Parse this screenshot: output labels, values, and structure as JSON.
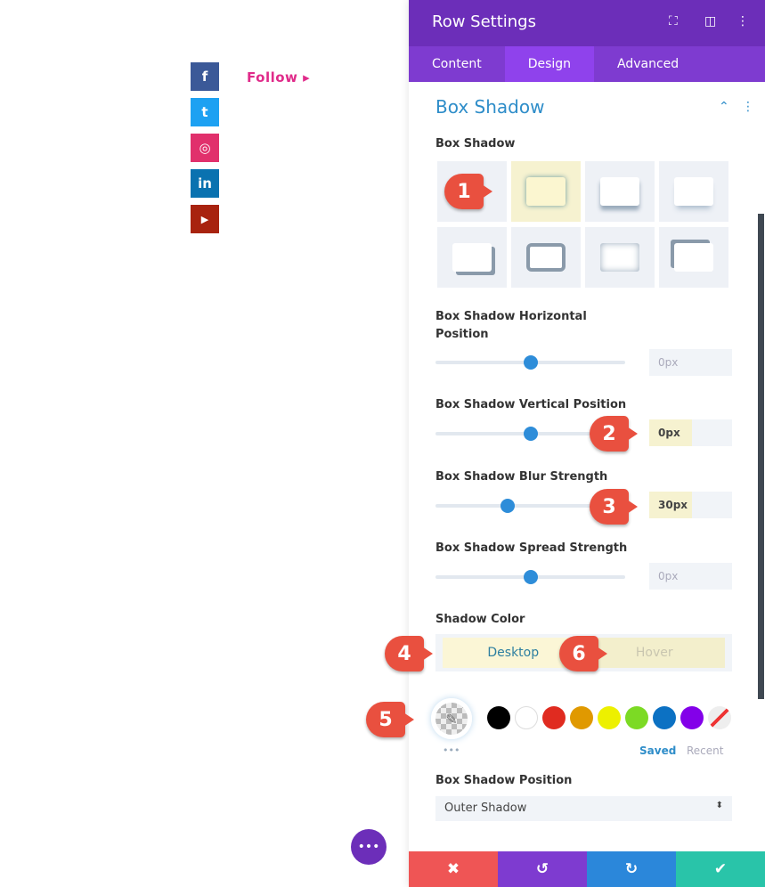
{
  "social": {
    "follow_label": "Follow ▸",
    "icons": [
      {
        "name": "facebook",
        "glyph": "f",
        "color": "#3b5998"
      },
      {
        "name": "twitter",
        "glyph": "t",
        "color": "#1da1f2"
      },
      {
        "name": "instagram",
        "glyph": "◎",
        "color": "#e1306c"
      },
      {
        "name": "linkedin",
        "glyph": "in",
        "color": "#0a72b0"
      },
      {
        "name": "youtube",
        "glyph": "▶",
        "color": "#a8230f"
      }
    ]
  },
  "panel": {
    "title": "Row Settings",
    "tabs": [
      "Content",
      "Design",
      "Advanced"
    ],
    "active_tab": "Design",
    "section_title": "Box Shadow",
    "box_shadow_label": "Box Shadow",
    "horizontal": {
      "label": "Box Shadow Horizontal Position",
      "value": "0px",
      "level": 0.5
    },
    "vertical": {
      "label": "Box Shadow Vertical Position",
      "value": "0px",
      "level": 0.5
    },
    "blur": {
      "label": "Box Shadow Blur Strength",
      "value": "30px",
      "level": 0.38
    },
    "spread": {
      "label": "Box Shadow Spread Strength",
      "value": "0px",
      "level": 0.5
    },
    "shadow_color": {
      "label": "Shadow Color",
      "desktop": "Desktop",
      "hover": "Hover",
      "swatches": [
        "#000000",
        "#ffffff",
        "#e02b20",
        "#e09900",
        "#edf000",
        "#7cda24",
        "#0c71c3",
        "#8300e9"
      ],
      "saved": "Saved",
      "recent": "Recent",
      "more": "•••"
    },
    "position": {
      "label": "Box Shadow Position",
      "value": "Outer Shadow"
    }
  },
  "annotations": [
    "1",
    "2",
    "3",
    "4",
    "5",
    "6"
  ],
  "footer": {
    "cancel": "✖",
    "undo": "↺",
    "redo": "↻",
    "save": "✔"
  },
  "fab": "•••"
}
